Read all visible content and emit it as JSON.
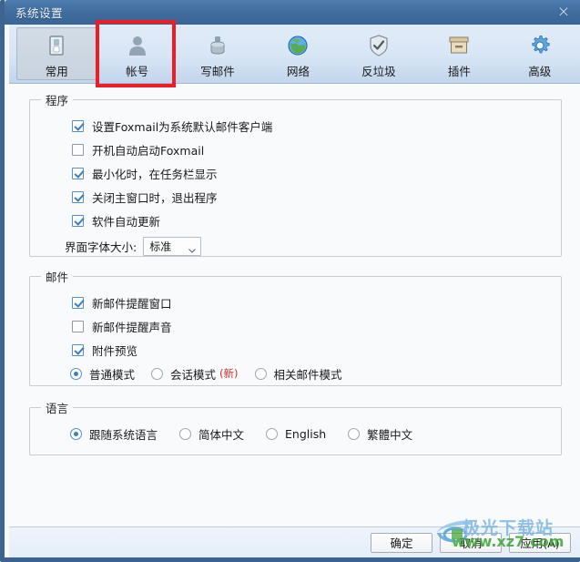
{
  "window": {
    "title": "系统设置",
    "close_label": "×"
  },
  "toolbar": {
    "tabs": [
      {
        "label": "常用",
        "icon": "general-icon",
        "selected": true
      },
      {
        "label": "帐号",
        "icon": "account-person-icon",
        "selected": false
      },
      {
        "label": "写邮件",
        "icon": "compose-mail-icon",
        "selected": false
      },
      {
        "label": "网络",
        "icon": "network-globe-icon",
        "selected": false
      },
      {
        "label": "反垃圾",
        "icon": "antispam-shield-icon",
        "selected": false
      },
      {
        "label": "插件",
        "icon": "plugin-box-icon",
        "selected": false
      },
      {
        "label": "高级",
        "icon": "advanced-gear-icon",
        "selected": false
      }
    ]
  },
  "groups": {
    "program": {
      "legend": "程序",
      "checkboxes": [
        {
          "label": "设置Foxmail为系统默认邮件客户端",
          "checked": true
        },
        {
          "label": "开机自动启动Foxmail",
          "checked": false
        },
        {
          "label": "最小化时，在任务栏显示",
          "checked": true
        },
        {
          "label": "关闭主窗口时，退出程序",
          "checked": true
        },
        {
          "label": "软件自动更新",
          "checked": true
        }
      ],
      "font_size": {
        "label": "界面字体大小:",
        "value": "标准"
      }
    },
    "mail": {
      "legend": "邮件",
      "checkboxes": [
        {
          "label": "新邮件提醒窗口",
          "checked": true
        },
        {
          "label": "新邮件提醒声音",
          "checked": false
        },
        {
          "label": "附件预览",
          "checked": true
        }
      ],
      "modes": [
        {
          "label": "普通模式",
          "selected": true,
          "badge": ""
        },
        {
          "label": "会话模式",
          "selected": false,
          "badge": "(新)"
        },
        {
          "label": "相关邮件模式",
          "selected": false,
          "badge": ""
        }
      ]
    },
    "language": {
      "legend": "语言",
      "options": [
        {
          "label": "跟随系统语言",
          "selected": true
        },
        {
          "label": "简体中文",
          "selected": false
        },
        {
          "label": "English",
          "selected": false
        },
        {
          "label": "繁體中文",
          "selected": false
        }
      ]
    }
  },
  "footer": {
    "buttons": [
      {
        "label": "确定"
      },
      {
        "label": "取消"
      },
      {
        "label": "应用(A)"
      }
    ]
  },
  "watermark": {
    "line1": "极光下载站",
    "line2": "www.xz7.com"
  },
  "colors": {
    "titlebar": "#416e9f",
    "accent": "#3c7ebf",
    "annotation": "#ee1c25",
    "badge_new": "#d4302a",
    "watermark_blue": "#7fb7e2",
    "watermark_green": "#3fa535"
  }
}
